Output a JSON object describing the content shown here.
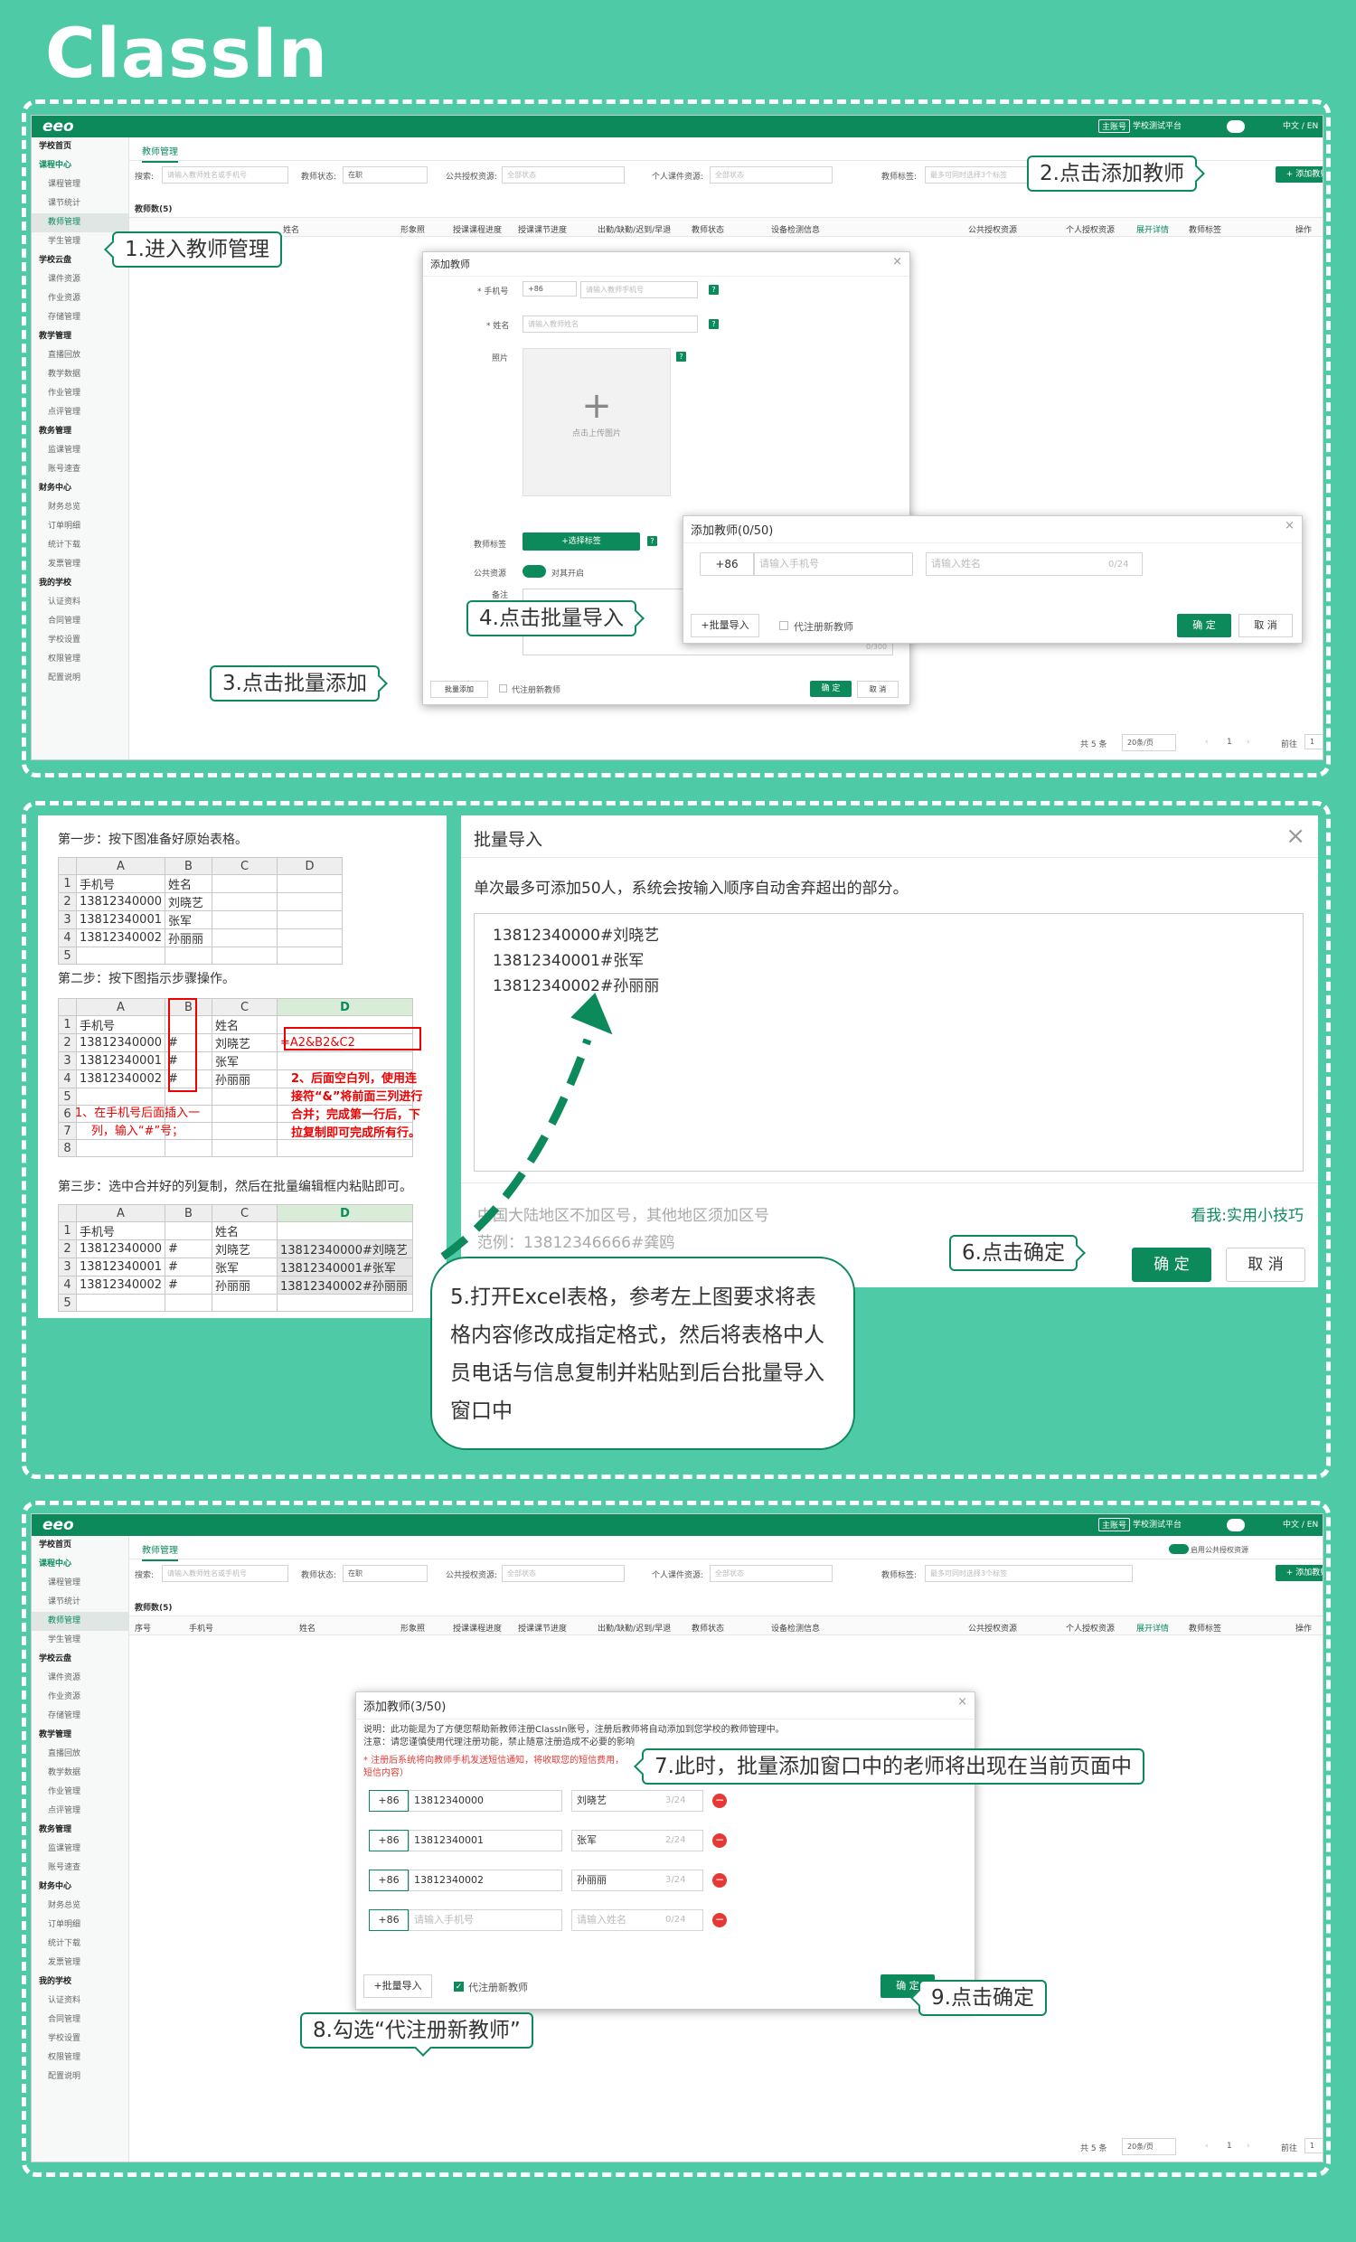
{
  "brand": "ClassIn",
  "topbar": {
    "logo": "eeo",
    "main_tag": "主账号",
    "org": "学校测试平台",
    "lang": "中文 / EN"
  },
  "sidebar": [
    {
      "label": "学校首页",
      "group": true
    },
    {
      "label": "课程中心",
      "group": true,
      "accent": true
    },
    {
      "label": "课程管理"
    },
    {
      "label": "课节统计"
    },
    {
      "label": "教师管理",
      "active": true
    },
    {
      "label": "学生管理"
    },
    {
      "label": "学校云盘",
      "group": true
    },
    {
      "label": "课件资源"
    },
    {
      "label": "作业资源"
    },
    {
      "label": "存储管理"
    },
    {
      "label": "教学管理",
      "group": true
    },
    {
      "label": "直播回放"
    },
    {
      "label": "教学数据"
    },
    {
      "label": "作业管理"
    },
    {
      "label": "点评管理"
    },
    {
      "label": "教务管理",
      "group": true
    },
    {
      "label": "监课管理"
    },
    {
      "label": "账号速查"
    },
    {
      "label": "财务中心",
      "group": true
    },
    {
      "label": "财务总览"
    },
    {
      "label": "订单明细"
    },
    {
      "label": "统计下载"
    },
    {
      "label": "发票管理"
    },
    {
      "label": "我的学校",
      "group": true
    },
    {
      "label": "认证资料"
    },
    {
      "label": "合同管理"
    },
    {
      "label": "学校设置"
    },
    {
      "label": "权限管理"
    },
    {
      "label": "配置说明"
    }
  ],
  "main": {
    "tab": "教师管理",
    "search_label": "搜索:",
    "search_placeholder": "请输入教师姓名或手机号",
    "status_label": "教师状态:",
    "status_value": "在职",
    "public_res_label": "公共授权资源:",
    "public_res_value": "全部状态",
    "personal_res_label": "个人课件资源:",
    "personal_res_value": "全部状态",
    "teacher_tag_label": "教师标签:",
    "teacher_tag_placeholder": "最多可同时选择3个标签",
    "add_button": "+ 添加教师",
    "public_switch": "启用公共授权资源",
    "count_label": "教师数(5)",
    "columns": [
      "序号",
      "手机号",
      "姓名",
      "形象照",
      "授课课程进度",
      "授课课节进度",
      "出勤/缺勤/迟到/早退",
      "教师状态",
      "设备检测信息",
      "公共授权资源",
      "个人授权资源",
      "展开详情",
      "教师标签",
      "操作"
    ],
    "pager": {
      "total": "共 5 条",
      "size": "20条/页",
      "page": "1",
      "goto": "前往",
      "goto_val": "1",
      "unit": "页"
    }
  },
  "dialog1": {
    "title": "添加教师",
    "phone_label": "* 手机号",
    "cc": "+86",
    "phone_ph": "请输入教师手机号",
    "name_label": "* 姓名",
    "name_ph": "请输入教师姓名",
    "name_count": "0/24",
    "photo_label": "照片",
    "upload_text": "点击上传图片",
    "tag_label": "教师标签",
    "tag_btn": "+选择标签",
    "pub_label": "公共资源",
    "pub_switch": "对其开启",
    "note_label": "备注",
    "note_count": "0/300",
    "batch_btn": "批量添加",
    "proxy_reg": "代注册新教师",
    "ok": "确 定",
    "cancel": "取 消"
  },
  "dialog2": {
    "title": "添加教师(0/50)",
    "cc": "+86",
    "phone_ph": "请输入手机号",
    "name_ph": "请输入姓名",
    "name_count": "0/24",
    "batch_import": "+批量导入",
    "proxy_reg": "代注册新教师",
    "ok": "确 定",
    "cancel": "取 消"
  },
  "callouts": {
    "c1": "1.进入教师管理",
    "c2": "2.点击添加教师",
    "c3": "3.点击批量添加",
    "c4": "4.点击批量导入",
    "c5": "5.打开Excel表格，参考左上图要求将表格内容修改成指定格式，然后将表格中人员电话与信息复制并粘贴到后台批量导入窗口中",
    "c6": "6.点击确定",
    "c7": "7.此时，批量添加窗口中的老师将出现在当前页面中",
    "c8": "8.勾选“代注册新教师”",
    "c9": "9.点击确定"
  },
  "excel": {
    "step1": "第一步：按下图准备好原始表格。",
    "step2": "第二步：按下图指示步骤操作。",
    "step3": "第三步：选中合并好的列复制，然后在批量编辑框内粘贴即可。",
    "cols": [
      "A",
      "B",
      "C",
      "D"
    ],
    "t1": [
      [
        "手机号",
        "姓名",
        "",
        ""
      ],
      [
        "13812340000",
        "刘晓艺",
        "",
        ""
      ],
      [
        "13812340001",
        "张军",
        "",
        ""
      ],
      [
        "13812340002",
        "孙丽丽",
        "",
        ""
      ]
    ],
    "t2": [
      [
        "手机号",
        "",
        "姓名",
        ""
      ],
      [
        "13812340000",
        "#",
        "刘晓艺",
        "=A2&B2&C2"
      ],
      [
        "13812340001",
        "#",
        "张军",
        ""
      ],
      [
        "13812340002",
        "#",
        "孙丽丽",
        ""
      ]
    ],
    "note1": "1、在手机号后面插入一列，输入“#”号；",
    "note2": "2、后面空白列，使用连接符“&”将前面三列进行合并；完成第一行后，下拉复制即可完成所有行。",
    "t3": [
      [
        "手机号",
        "",
        "姓名",
        ""
      ],
      [
        "13812340000",
        "#",
        "刘晓艺",
        "13812340000#刘晓艺"
      ],
      [
        "13812340001",
        "#",
        "张军",
        "13812340001#张军"
      ],
      [
        "13812340002",
        "#",
        "孙丽丽",
        "13812340002#孙丽丽"
      ]
    ]
  },
  "batch": {
    "title": "批量导入",
    "desc": "单次最多可添加50人，系统会按输入顺序自动舍弃超出的部分。",
    "lines": [
      "13812340000#刘晓艺",
      "13812340001#张军",
      "13812340002#孙丽丽"
    ],
    "hint": "中国大陆地区不加区号，其他地区须加区号",
    "example": "范例：13812346666#龚鸥",
    "tips_link": "看我:实用小技巧",
    "ok": "确 定",
    "cancel": "取 消"
  },
  "dialog3": {
    "title": "添加教师(3/50)",
    "desc1": "说明：此功能是为了方便您帮助新教师注册ClassIn账号，注册后教师将自动添加到您学校的教师管理中。",
    "desc2": "注意：请您谨慎使用代理注册功能，禁止随意注册造成不必要的影响",
    "warn": "* 注册后系统将向教师手机发送短信通知，将收取您的短信费用，",
    "warn2": "短信内容）",
    "rows": [
      {
        "cc": "+86",
        "phone": "13812340000",
        "name": "刘晓艺",
        "count": "3/24"
      },
      {
        "cc": "+86",
        "phone": "13812340001",
        "name": "张军",
        "count": "2/24"
      },
      {
        "cc": "+86",
        "phone": "13812340002",
        "name": "孙丽丽",
        "count": "3/24"
      },
      {
        "cc": "+86",
        "phone": "请输入手机号",
        "name": "请输入姓名",
        "count": "0/24"
      }
    ],
    "batch_import": "+批量导入",
    "proxy_reg": "代注册新教师",
    "ok": "确 定"
  },
  "colors": {
    "brand": "#0c8a5c",
    "bg": "#4ecba6",
    "red": "#e53935"
  }
}
